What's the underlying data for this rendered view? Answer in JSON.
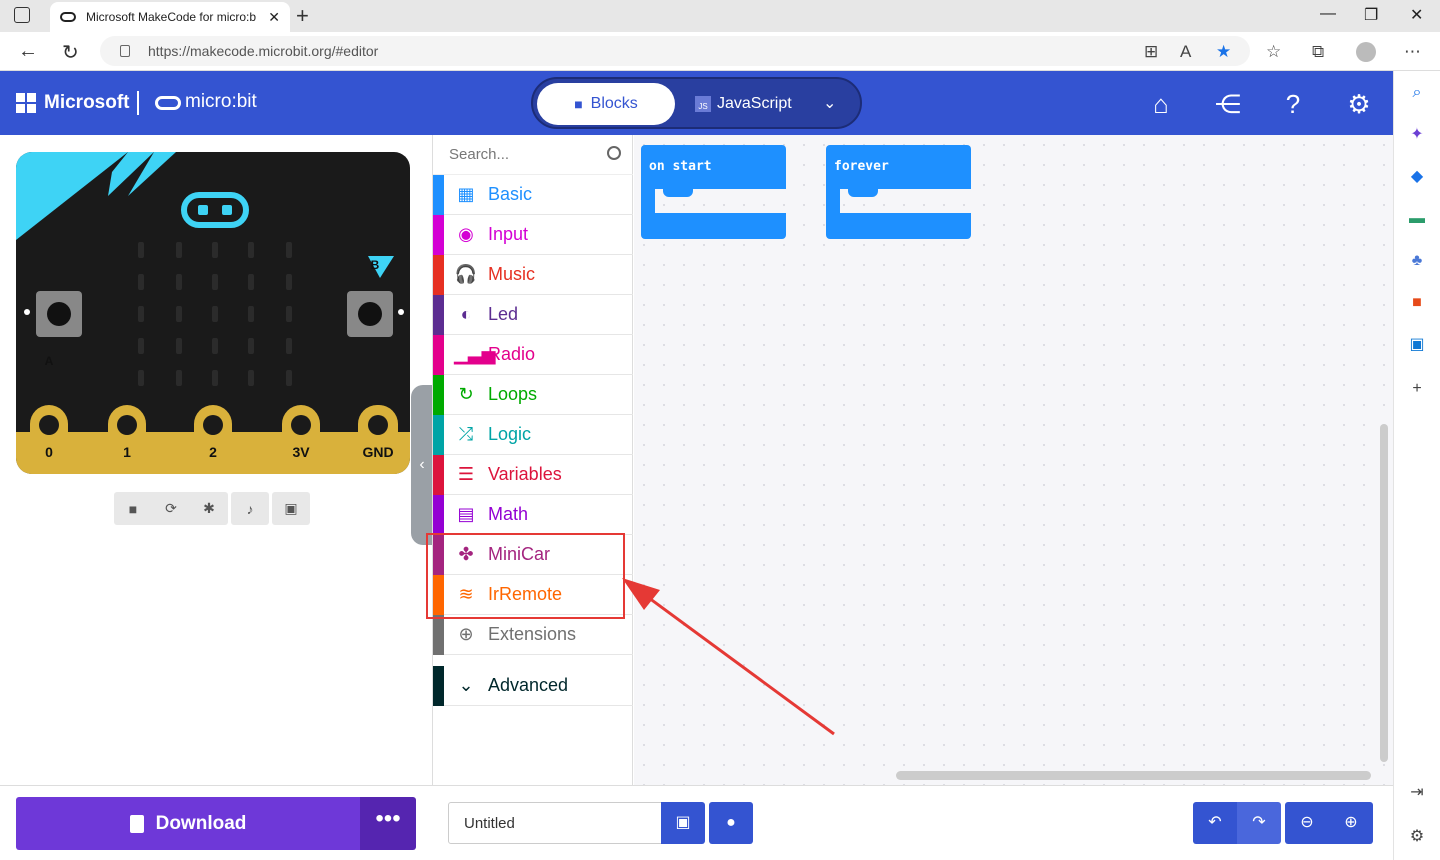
{
  "browser": {
    "tab_title": "Microsoft MakeCode for micro:b",
    "tab_close": "✕",
    "new_tab": "+",
    "url": "https://makecode.microbit.org/#editor",
    "window_controls": [
      "—",
      "❐",
      "✕"
    ]
  },
  "header": {
    "brand": "Microsoft",
    "product": "micro:bit",
    "modes": {
      "blocks": "Blocks",
      "javascript": "JavaScript",
      "js_badge": "JS"
    }
  },
  "board": {
    "button_a": "A",
    "button_b": "B",
    "pins": [
      "0",
      "1",
      "2",
      "3V",
      "GND"
    ]
  },
  "toolbox": {
    "search_placeholder": "Search...",
    "categories": [
      {
        "label": "Basic",
        "color": "#1e90ff"
      },
      {
        "label": "Input",
        "color": "#d400d4"
      },
      {
        "label": "Music",
        "color": "#e63022"
      },
      {
        "label": "Led",
        "color": "#5c2d91"
      },
      {
        "label": "Radio",
        "color": "#e3008c"
      },
      {
        "label": "Loops",
        "color": "#00aa00"
      },
      {
        "label": "Logic",
        "color": "#00a4a6"
      },
      {
        "label": "Variables",
        "color": "#dc143c"
      },
      {
        "label": "Math",
        "color": "#9400d3"
      },
      {
        "label": "MiniCar",
        "color": "#a4247f"
      },
      {
        "label": "IrRemote",
        "color": "#ff6600"
      },
      {
        "label": "Extensions",
        "color": "#707070"
      },
      {
        "label": "Advanced",
        "color": "#00272b"
      }
    ]
  },
  "workspace": {
    "blocks": [
      {
        "label": "on start"
      },
      {
        "label": "forever"
      }
    ]
  },
  "bottom": {
    "download": "Download",
    "more": "•••",
    "project_name": "Untitled"
  }
}
